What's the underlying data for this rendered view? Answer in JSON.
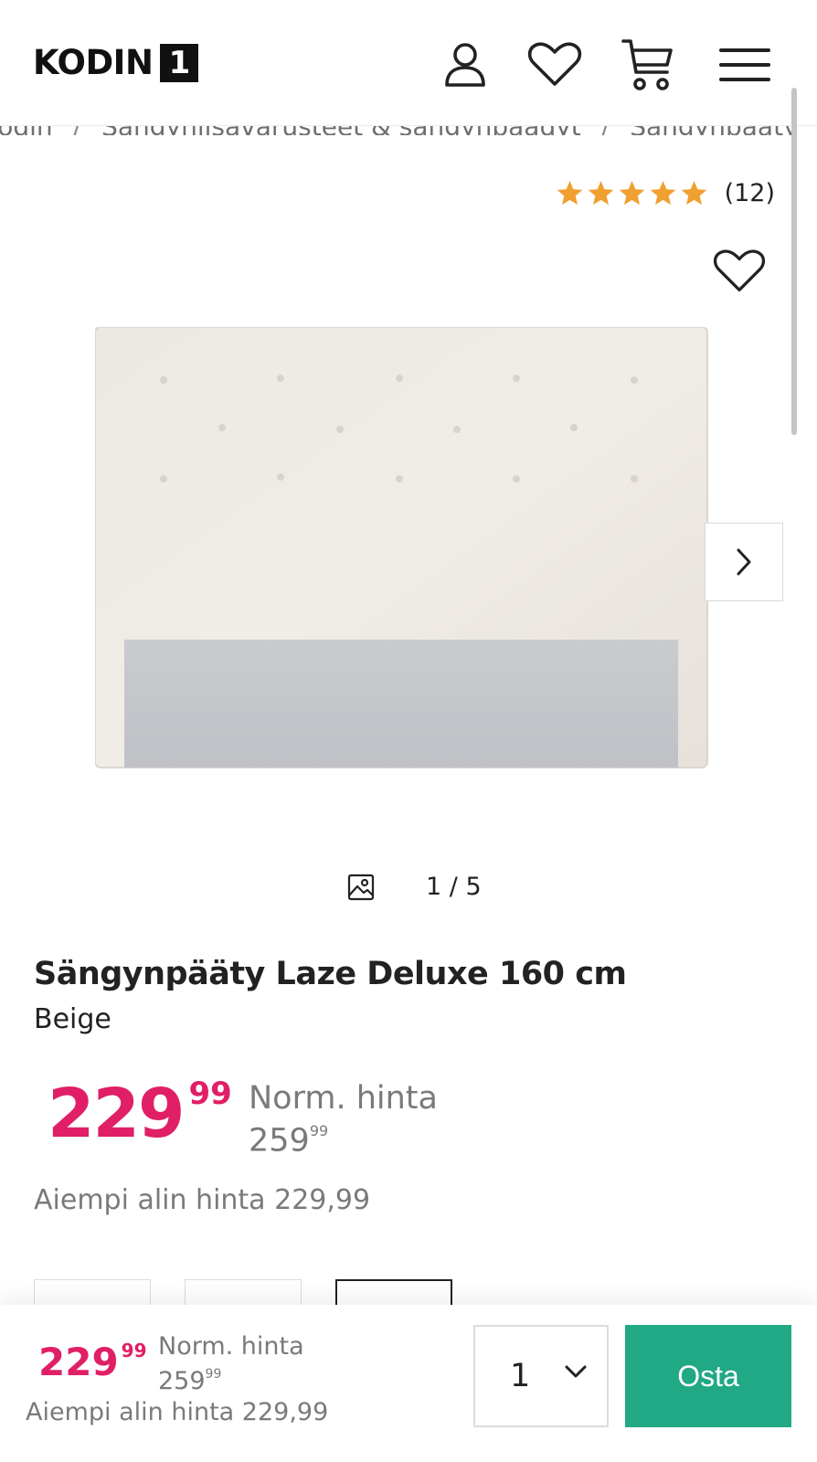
{
  "header": {
    "logo_text": "KODIN",
    "logo_box": "1",
    "icons": [
      "user-icon",
      "heart-icon",
      "cart-icon",
      "menu-icon"
    ]
  },
  "breadcrumb": {
    "items": [
      "kodin",
      "Sängynlisävarusteet & sängynpäädyt",
      "Sängynpääty"
    ]
  },
  "rating": {
    "stars": 5,
    "count_label": "(12)"
  },
  "gallery": {
    "counter": "1 / 5"
  },
  "product": {
    "title": "Sängynpääty Laze Deluxe 160 cm",
    "variant": "Beige"
  },
  "price": {
    "current_int": "229",
    "current_dec": "99",
    "norm_label": "Norm. hinta",
    "norm_int": "259",
    "norm_dec": "99",
    "lowest": "Aiempi alin hinta 229,99"
  },
  "sticky": {
    "current_int": "229",
    "current_dec": "99",
    "norm_label": "Norm. hinta",
    "norm_int": "259",
    "norm_dec": "99",
    "lowest": "Aiempi alin hinta 229,99",
    "quantity": "1",
    "buy_label": "Osta"
  },
  "colors": {
    "price": "#e01f66",
    "buy_button": "#21a884",
    "star": "#f0a030"
  }
}
